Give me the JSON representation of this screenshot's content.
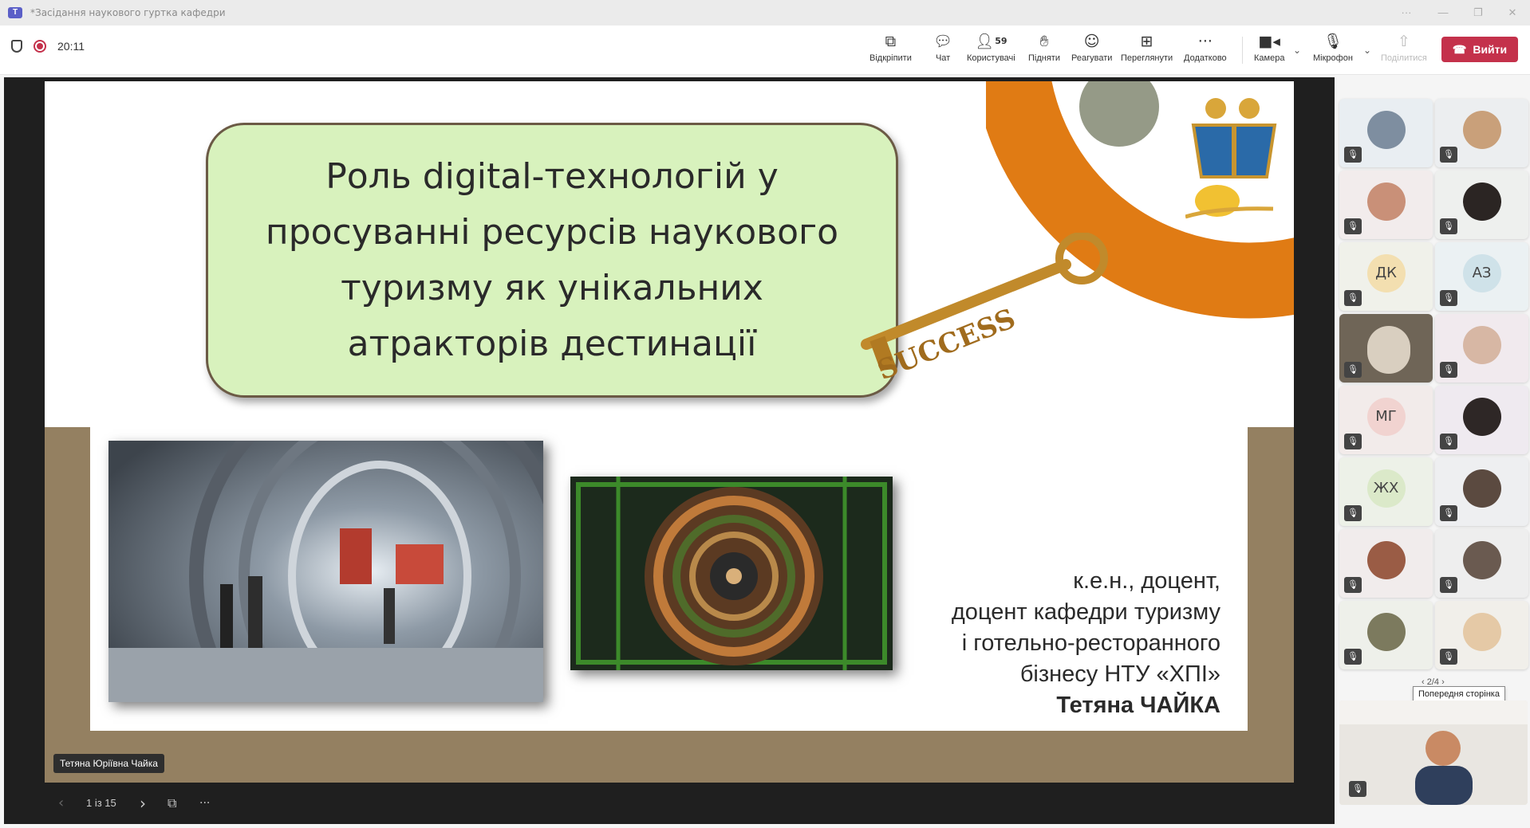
{
  "window": {
    "title": "*Засідання наукового гуртка кафедри"
  },
  "toolbar": {
    "timer": "20:11",
    "participants_count": "59",
    "buttons": [
      {
        "label": "Відкріпити",
        "icon": "unpin-icon"
      },
      {
        "label": "Чат",
        "icon": "chat-icon"
      },
      {
        "label": "Користувачі",
        "icon": "people-icon"
      },
      {
        "label": "Підняти",
        "icon": "raise-hand-icon"
      },
      {
        "label": "Реагувати",
        "icon": "react-icon"
      },
      {
        "label": "Переглянути",
        "icon": "view-icon"
      },
      {
        "label": "Додатково",
        "icon": "more-icon"
      },
      {
        "label": "Камера",
        "icon": "camera-icon"
      },
      {
        "label": "Мікрофон",
        "icon": "mic-off-icon"
      },
      {
        "label": "Поділитися",
        "icon": "share-icon"
      }
    ],
    "leave_label": "Вийти"
  },
  "slide": {
    "title": "Роль digital-технологій у просуванні ресурсів наукового туризму як унікальних атракторів дестинації",
    "key_text": "SUCCESS",
    "author_lines": [
      "к.е.н., доцент,",
      "доцент кафедри туризму",
      "і готельно-ресторанного",
      "бізнесу НТУ «ХПІ»"
    ],
    "author_name": "Тетяна ЧАЙКА"
  },
  "presenter": {
    "name": "Тетяна Юріївна Чайка"
  },
  "slide_nav": {
    "position": "1 із 15"
  },
  "gallery": {
    "initials": [
      "ДК",
      "АЗ",
      "МГ",
      "ЖХ"
    ],
    "page": "2/4",
    "tooltip": "Попередня сторінка"
  },
  "colors": {
    "leave": "#c4314b",
    "title_box": "#d8f2bd",
    "band": "#948061",
    "ring": "#e07b14"
  }
}
